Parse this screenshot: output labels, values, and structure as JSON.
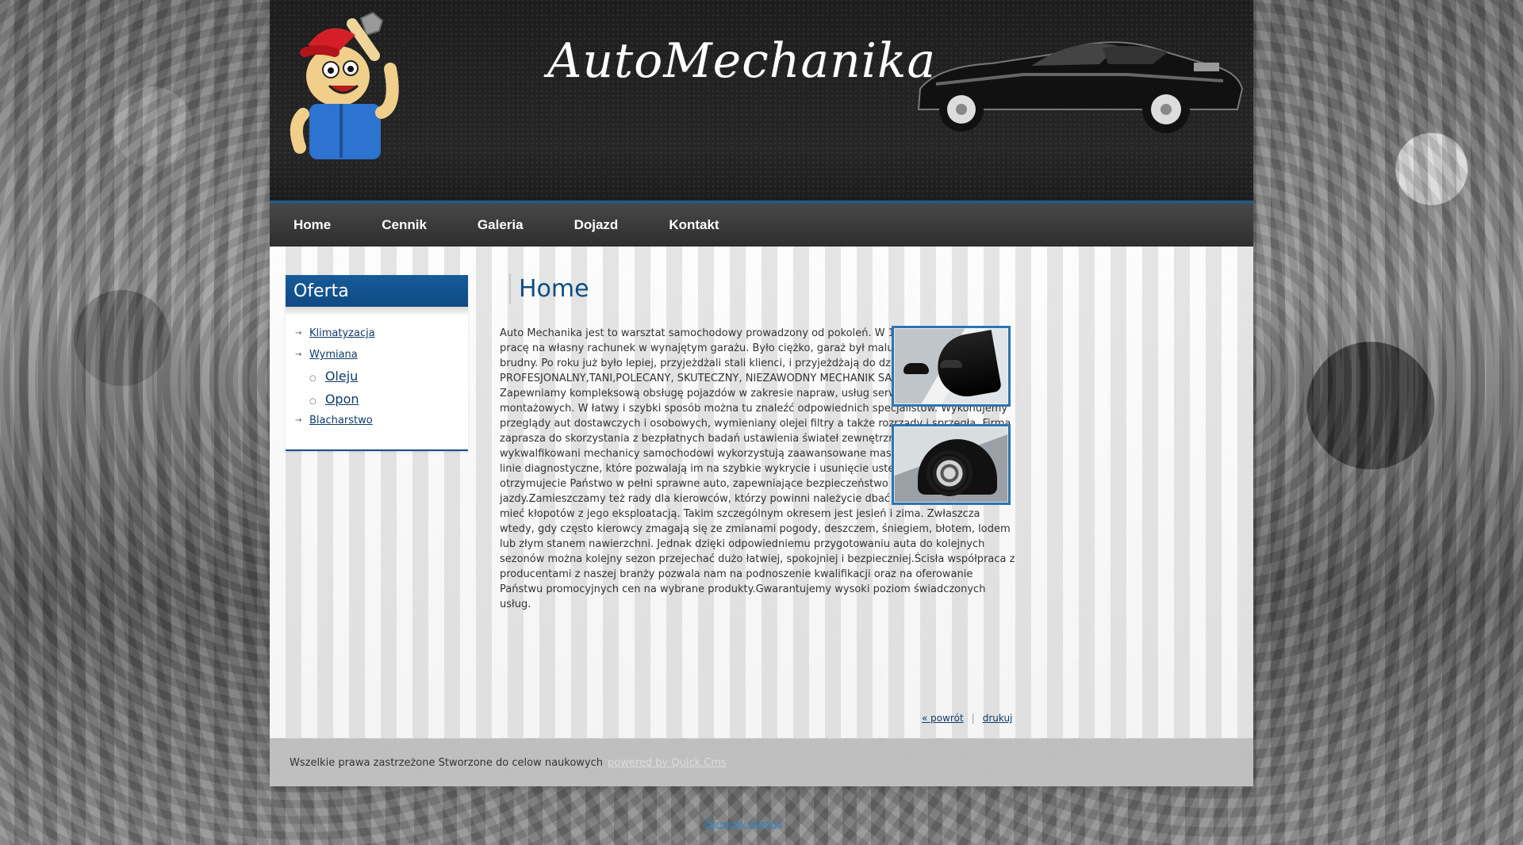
{
  "header": {
    "title": "AutoMechanika"
  },
  "nav": {
    "items": [
      {
        "label": "Home"
      },
      {
        "label": "Cennik"
      },
      {
        "label": "Galeria"
      },
      {
        "label": "Dojazd"
      },
      {
        "label": "Kontakt"
      }
    ]
  },
  "sidebar": {
    "title": "Oferta",
    "items": [
      {
        "label": "Klimatyzacja"
      },
      {
        "label": "Wymiana"
      },
      {
        "label": "Oleju"
      },
      {
        "label": "Opon"
      },
      {
        "label": "Blacharstwo"
      }
    ]
  },
  "main": {
    "title": "Home",
    "article_text": "Auto Mechanika jest to warsztat samochodowy prowadzony od pokoleń. W 1987 roku zaczynałem pracę na własny rachunek w wynajętym garażu. Było ciężko, garaż był malutki, kanał wąski i brudny. Po roku już było lepiej, przyjeżdżali stali klienci, i przyjeżdżają do dziś. AUTO MECHANIKA-PROFESJONALNY,TANI,POLECANY, SKUTECZNY, NIEZAWODNY MECHANIK SAMOCHODOWY. Zapewniamy kompleksową obsługę pojazdów w zakresie napraw, usług serwisowych i montażowych. W łatwy i szybki sposób można tu znaleźć odpowiednich specjalistów. Wykonujemy przeglądy aut dostawczych i osobowych, wymieniany olejei filtry a także rozrządy i sprzęgła. Firma zaprasza do skorzystania z bezpłatnych badań ustawienia świateł zewnętrznych pojazdów. Nasi wykwalfikowani mechanicy samochodowi wykorzystują zaawansowane maszyny oraz innowacyjne linie diagnostyczne, które pozwalają im na szybkie wykrycie i usunięcie usterki. Dzięki temu otrzymujecie Państwo w pełni sprawne auto, zapewniające bezpieczeństwo i komfort jazdy.Zamieszczamy też rady dla kierowców, którzy powinni należycie dbać o swój pojazd, by nie mieć kłopotów z jego eksploatacją. Takim szczególnym okresem jest jesień i zima. Zwłaszcza wtedy, gdy często kierowcy zmagają się ze zmianami pogody, deszczem, śniegiem, błotem, lodem lub złym stanem nawierzchni. Jednak dzięki odpowiedniemu przygotowaniu auta do kolejnych sezonów można kolejny sezon przejechać dużo łatwiej, spokojniej i bezpieczniej.Ścisła współpraca z producentami z naszej branży pozwala nam na podnoszenie kwalifikacji oraz na oferowanie Państwu promocyjnych cen na wybrane produkty.Gwarantujemy wysoki poziom świadczonych usług.",
    "back_label": "« powrót",
    "print_label": "drukuj"
  },
  "footer": {
    "text": "Wszelkie prawa zastrzeżone Stworzone do celow naukowych",
    "powered_label": "powered by Quick.Cms"
  },
  "bottom_link": "Darmowy Hosting"
}
